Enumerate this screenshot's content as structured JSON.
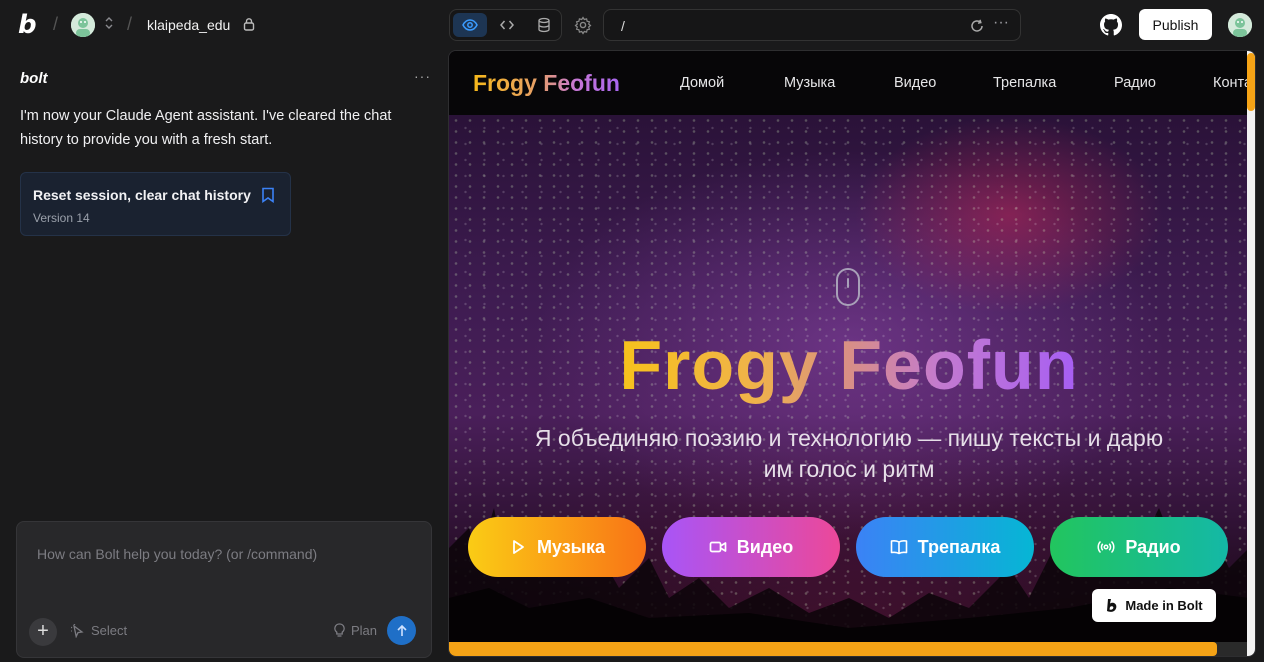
{
  "topbar": {
    "project_name": "klaipeda_edu",
    "url": "/",
    "publish_label": "Publish"
  },
  "chat": {
    "brand": "bolt",
    "message": "I'm now your Claude Agent assistant. I've cleared the chat history to provide you with a fresh start.",
    "version_card": {
      "title": "Reset session, clear chat history",
      "version": "Version 14"
    },
    "input_placeholder": "How can Bolt help you today? (or /command)",
    "select_label": "Select",
    "plan_label": "Plan"
  },
  "site": {
    "logo": "Frogy Feofun",
    "nav": [
      "Домой",
      "Музыка",
      "Видео",
      "Трепалка",
      "Радио",
      "Конта"
    ],
    "hero_title": "Frogy Feofun",
    "hero_subtitle": "Я объединяю поэзию и технологию — пишу тексты и дарю им голос и ритм",
    "buttons": [
      {
        "label": "Музыка",
        "icon": "play-icon",
        "color_from": "#facc15",
        "color_to": "#f97316"
      },
      {
        "label": "Видео",
        "icon": "video-icon",
        "color_from": "#a855f7",
        "color_to": "#ec4899"
      },
      {
        "label": "Трепалка",
        "icon": "book-icon",
        "color_from": "#3b82f6",
        "color_to": "#06b6d4"
      },
      {
        "label": "Радио",
        "icon": "radio-icon",
        "color_from": "#22c55e",
        "color_to": "#14b8a6"
      }
    ],
    "made_in_bolt": "Made in Bolt",
    "scroll_progress": 0.96
  },
  "colors": {
    "accent_orange": "#f5a316",
    "publish_bg": "#ffffff",
    "send_button": "#1f6fc7"
  }
}
